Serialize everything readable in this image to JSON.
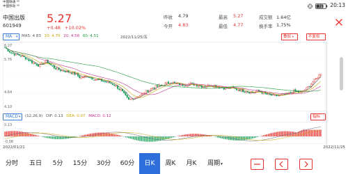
{
  "status_bar": {
    "carrier_line1": "中国联通 ᴴᴰ",
    "carrier_line2": "中国移动 ᴴᴰ",
    "battery": "70",
    "time": "20:13"
  },
  "header": {
    "stock_name": "中国出版",
    "stock_code": "601949",
    "price": "5.27",
    "change": "+0.48",
    "change_pct": "+10.02%",
    "yesterday_label": "昨收",
    "yesterday_value": "4.79",
    "open_label": "今开",
    "open_value": "4.83",
    "high_label": "最高",
    "high_value": "5.27",
    "low_label": "最低",
    "low_value": "4.77",
    "amount_label": "成交额",
    "amount_value": "1.64亿",
    "turnover_label": "换手率",
    "turnover_value": "1.75%"
  },
  "toolbar": {
    "indicator": "MA",
    "ma5": "MA5: 4.83",
    "ma10": "10: 4.70",
    "ma20": "20: 4.58",
    "ma60": "60: 4.51",
    "date": "2022/11/25/五",
    "overlay_btn": "叠加",
    "adjust_btn": "不复权"
  },
  "macd": {
    "indicator": "MACD",
    "params": "(12,26,9)",
    "dif": "DIF: 0.13",
    "dea": "DEA: 0.07",
    "macd": "MACD: 0.12"
  },
  "axis": {
    "y_top": "6.27",
    "y_upper": "5.76",
    "y_lower": "4.64",
    "y_bottom": "4.10",
    "macd_top": "0.13",
    "macd_bottom": "-0.08",
    "date_start": "2022/01/21",
    "date_end": "2022/11/25"
  },
  "tabs": [
    {
      "label": "分时",
      "active": false
    },
    {
      "label": "五日",
      "active": false
    },
    {
      "label": "5分",
      "active": false
    },
    {
      "label": "15分",
      "active": false
    },
    {
      "label": "30分",
      "active": false
    },
    {
      "label": "60分",
      "active": false
    },
    {
      "label": "日K",
      "active": true
    },
    {
      "label": "周K",
      "active": false
    },
    {
      "label": "月K",
      "active": false
    },
    {
      "label": "周期",
      "active": false
    }
  ],
  "colors": {
    "up": "#e8312e",
    "down": "#17a25a",
    "accent": "#2f6fdb",
    "ma5": "#555555",
    "ma10": "#c8a600",
    "ma20": "#c4348f",
    "ma60": "#1e9a3e"
  },
  "chart_data": {
    "type": "candlestick",
    "x_range": [
      "2022/01/21",
      "2022/11/25"
    ],
    "ylim": [
      4.1,
      6.27
    ],
    "close_path": [
      6.15,
      5.95,
      5.9,
      5.8,
      5.65,
      5.55,
      5.7,
      5.5,
      5.4,
      5.35,
      5.3,
      5.15,
      5.2,
      5.1,
      5.05,
      5.0,
      4.9,
      4.7,
      4.4,
      4.5,
      4.6,
      4.75,
      4.85,
      4.9,
      5.0,
      4.95,
      4.9,
      4.95,
      4.9,
      4.85,
      4.9,
      4.85,
      4.8,
      4.8,
      4.75,
      4.7,
      4.65,
      4.7,
      4.6,
      4.55,
      4.55,
      4.6,
      4.7,
      4.65,
      4.8,
      5.05,
      5.27
    ],
    "macd_range": [
      -0.08,
      0.13
    ]
  }
}
